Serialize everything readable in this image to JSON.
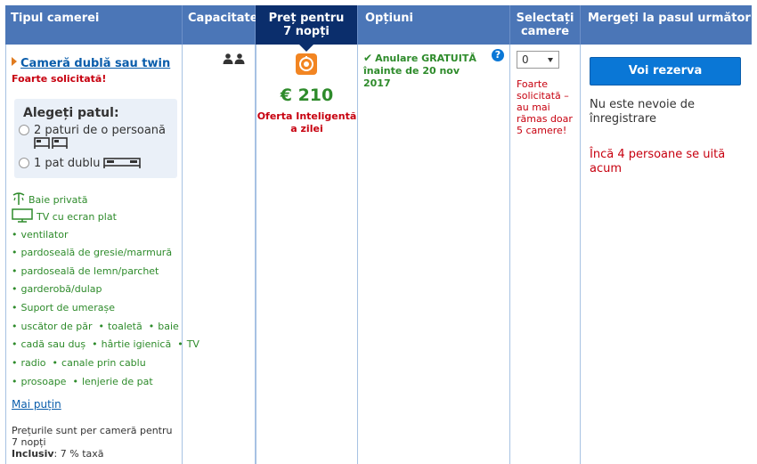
{
  "headers": {
    "room_type": "Tipul camerei",
    "capacity": "Capacitate",
    "price": "Preț pentru 7 nopți",
    "options": "Opțiuni",
    "select_rooms": "Selectați camere",
    "next_step": "Mergeți la pasul următor"
  },
  "room": {
    "name": "Cameră dublă sau twin",
    "demand": "Foarte solicitată!",
    "bed_title": "Alegeți patul:",
    "bed_options": [
      "2 paturi de o persoană",
      "1 pat dublu"
    ],
    "facilities": [
      "Baie privată",
      "TV cu ecran plat",
      "ventilator",
      "pardoseală de gresie/marmură",
      "pardoseală de lemn/parchet",
      "garderobă/dulap",
      "Suport de umerașe",
      "uscător de păr",
      "toaletă",
      "baie",
      "cadă sau duș",
      "hârtie igienică",
      "TV",
      "radio",
      "canale prin cablu",
      "prosoape",
      "lenjerie de pat"
    ],
    "less_link": "Mai puțin",
    "price_note": "Prețurile sunt per cameră pentru 7 nopți",
    "included_label": "Inclusiv",
    "tax_text": ": 7 % taxă"
  },
  "capacity_icon": "two-persons-icon",
  "price": {
    "icon": "smart-deal-icon",
    "value": "€ 210",
    "offer": "Oferta Inteligentă a zilei"
  },
  "option": {
    "text": "Anulare GRATUITĂ înainte de 20 nov 2017",
    "icon": "check-icon"
  },
  "select": {
    "value": "0",
    "note": "Foarte solicitată – au mai rămas doar 5 camere!"
  },
  "action": {
    "button": "Voi rezerva",
    "no_registration": "Nu este nevoie de înregistrare",
    "watching": "Încă 4 persoane se uită acum"
  },
  "colors": {
    "header_bg": "#4b76b7",
    "active_header_bg": "#0b2e6c",
    "green": "#2e8b2b",
    "red": "#c7000f",
    "link": "#0a5dab",
    "button": "#0a77d6"
  }
}
